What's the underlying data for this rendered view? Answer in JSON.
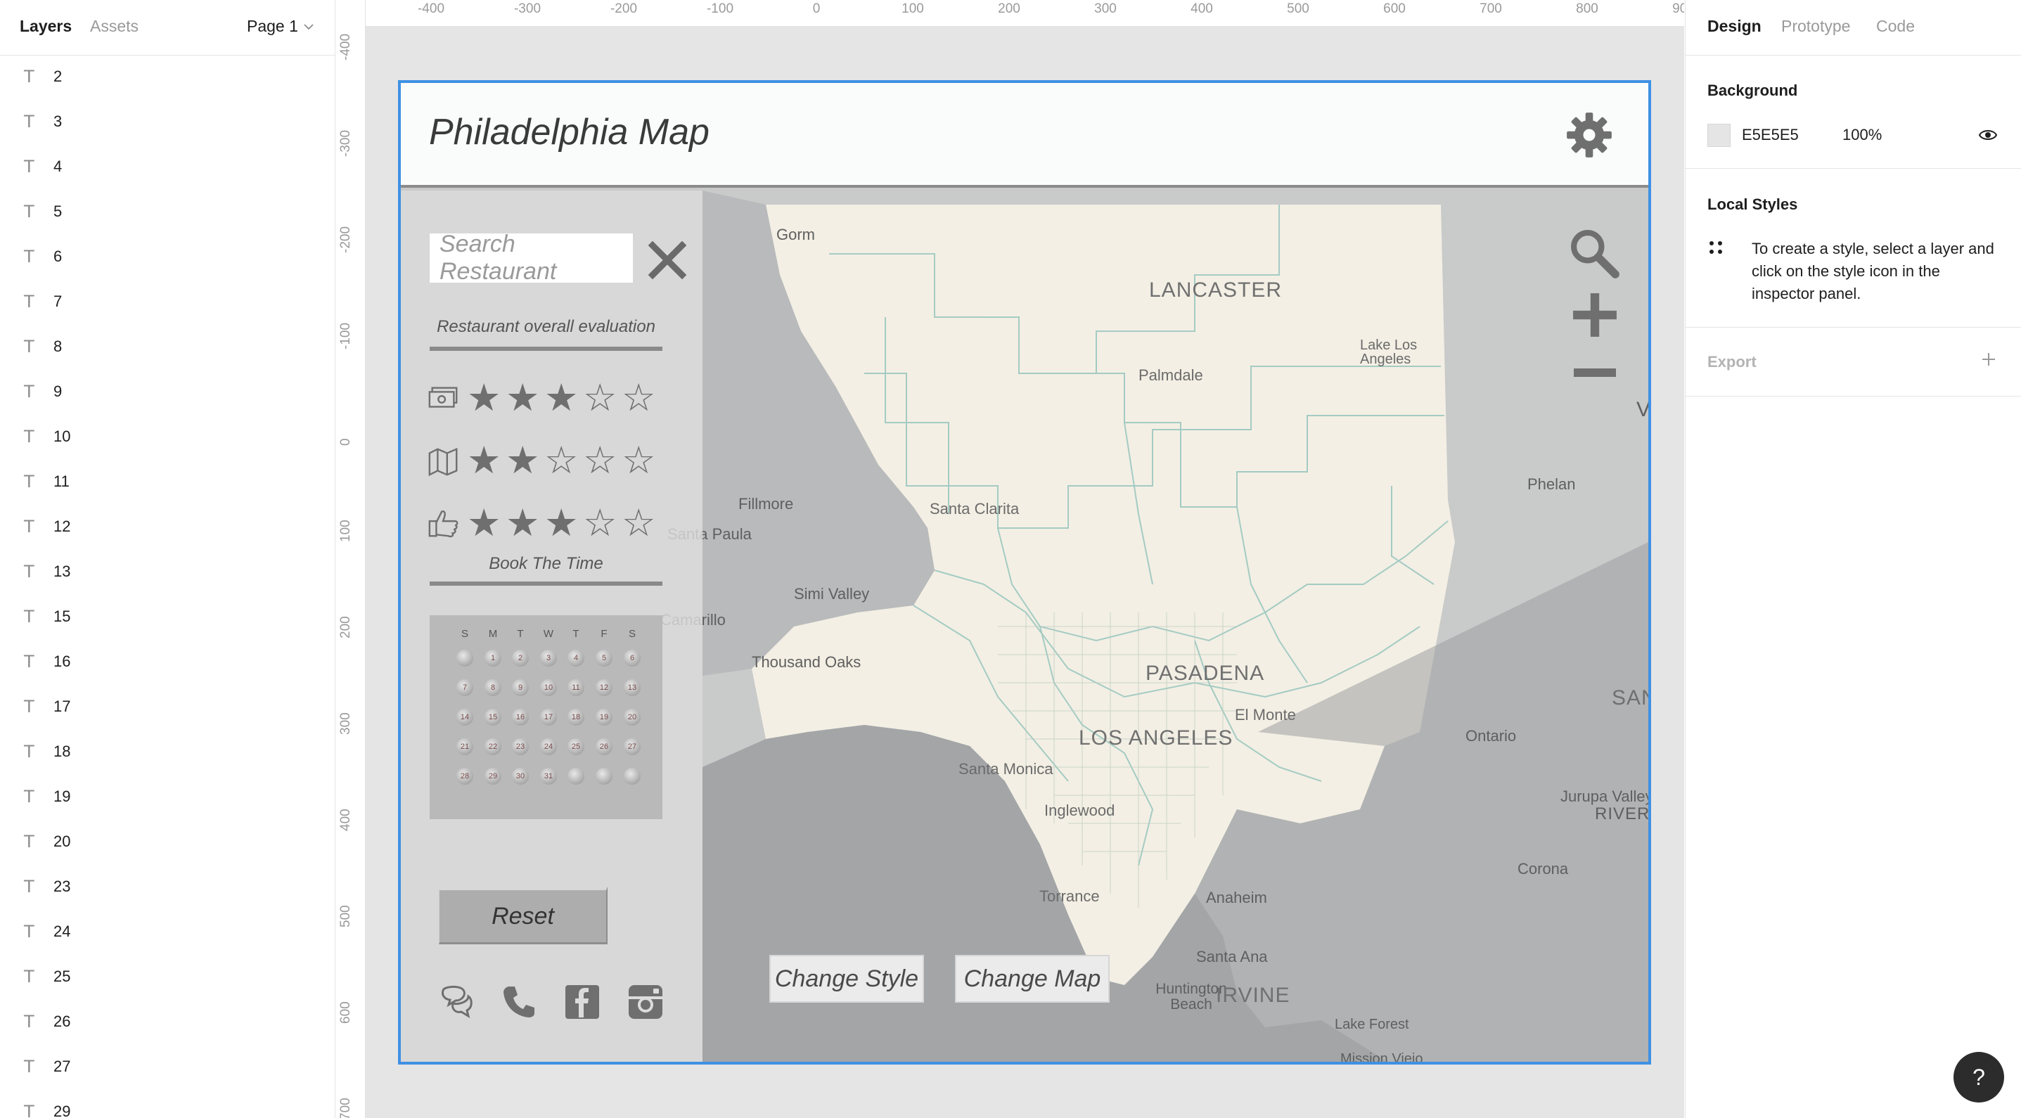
{
  "layers_panel": {
    "tab_layers": "Layers",
    "tab_assets": "Assets",
    "page_select": "Page 1",
    "layer_type_glyph": "T",
    "items": [
      "2",
      "3",
      "4",
      "5",
      "6",
      "7",
      "8",
      "9",
      "10",
      "11",
      "12",
      "13",
      "15",
      "16",
      "17",
      "18",
      "19",
      "20",
      "23",
      "24",
      "25",
      "26",
      "27",
      "29"
    ]
  },
  "rulers": {
    "top": [
      "-400",
      "-300",
      "-200",
      "-100",
      "0",
      "100",
      "200",
      "300",
      "400",
      "500",
      "600",
      "700",
      "800",
      "900"
    ],
    "left": [
      "-400",
      "-300",
      "-200",
      "-100",
      "0",
      "100",
      "200",
      "300",
      "400",
      "500",
      "600",
      "700"
    ]
  },
  "frame": {
    "title": "Philadelphia Map",
    "search_placeholder": "Search Restaurant",
    "evaluation_title": "Restaurant overall evaluation",
    "ratings": [
      {
        "icon": "money-icon",
        "stars": 3,
        "max": 5
      },
      {
        "icon": "map-icon",
        "stars": 2,
        "max": 5
      },
      {
        "icon": "thumbs-up-icon",
        "stars": 3,
        "max": 5
      }
    ],
    "star_filled": "★",
    "star_empty": "☆",
    "book_title": "Book The Time",
    "calendar": {
      "weekdays": [
        "S",
        "M",
        "T",
        "W",
        "T",
        "F",
        "S"
      ],
      "days": [
        "",
        "1",
        "2",
        "3",
        "4",
        "5",
        "6",
        "7",
        "8",
        "9",
        "10",
        "11",
        "12",
        "13",
        "14",
        "15",
        "16",
        "17",
        "18",
        "19",
        "20",
        "21",
        "22",
        "23",
        "24",
        "25",
        "26",
        "27",
        "28",
        "29",
        "30",
        "31",
        "",
        "",
        ""
      ]
    },
    "reset_label": "Reset",
    "change_style_label": "Change Style",
    "change_map_label": "Change Map",
    "social_icons": [
      "chat-icon",
      "phone-icon",
      "facebook-icon",
      "instagram-icon"
    ],
    "map_labels": {
      "gorman": "Gorm",
      "lancaster": "LANCASTER",
      "palmdale": "Palmdale",
      "lake_los_angeles": "Lake Los Angeles",
      "fillmore": "Fillmore",
      "santa_paula": "Santa Paula",
      "santa_clarita": "Santa Clarita",
      "phelan": "Phelan",
      "simi_valley": "Simi Valley",
      "camarillo": "Camarillo",
      "thousand_oaks": "Thousand Oaks",
      "pasadena": "PASADENA",
      "los_angeles": "LOS ANGELES",
      "el_monte": "El Monte",
      "san": "SAN",
      "ontario": "Ontario",
      "santa_monica": "Santa Monica",
      "inglewood": "Inglewood",
      "jurupa_valley": "Jurupa Valley",
      "riverside": "RIVER",
      "torrance": "Torrance",
      "anaheim": "Anaheim",
      "corona": "Corona",
      "santa_ana": "Santa Ana",
      "huntington_beach": "Huntington Beach",
      "irvine": "IRVINE",
      "lake_forest": "Lake Forest",
      "mission_viejo": "Mission Viejo",
      "victorville_fragment": "V"
    }
  },
  "right_panel": {
    "tab_design": "Design",
    "tab_prototype": "Prototype",
    "tab_code": "Code",
    "background_heading": "Background",
    "background_hex": "E5E5E5",
    "background_opacity": "100%",
    "local_styles_heading": "Local Styles",
    "local_styles_hint": "To create a style, select a layer and click on the style icon in the inspector panel.",
    "export_label": "Export",
    "help_label": "?"
  },
  "colors": {
    "canvas": "#e5e5e5",
    "frame_border": "#3f91e4",
    "map_land": "#f3efe4",
    "map_water": "#a9abad",
    "map_boundary": "#9cc8c0",
    "sidebar_overlay": "#dcdcdc"
  }
}
